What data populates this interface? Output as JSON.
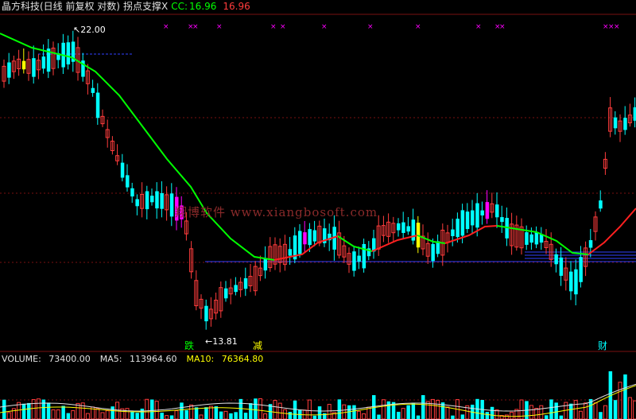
{
  "header": {
    "security_name": "晶方科技(日线 前复权 对数)",
    "indicator_name": "拐点支撑X",
    "cc_label": "CC:",
    "cc_value": "16.96",
    "last_value": "16.96"
  },
  "volume_header": {
    "volume_label": "VOLUME:",
    "volume_value": "73400.00",
    "ma5_label": "MA5:",
    "ma5_value": "113964.60",
    "ma10_label": "MA10:",
    "ma10_value": "76364.80"
  },
  "annotations": {
    "high": "22.00",
    "low": "13.81",
    "sig_fall": "跌",
    "sig_reduce": "减",
    "sig_finance": "财"
  },
  "watermark": "翔博软件 www.xiangbosoft.com",
  "colors": {
    "background": "#000000",
    "grid": "#7a1010",
    "up": "#ff3c3c",
    "down": "#00ffff",
    "magenta": "#ff00ff",
    "yellow": "#ffff00",
    "ma_green": "#00ff00",
    "ma_red": "#ff2020",
    "support": "#3040ff",
    "cc_color": "#00ff00",
    "last_color": "#ff3c3c"
  }
}
